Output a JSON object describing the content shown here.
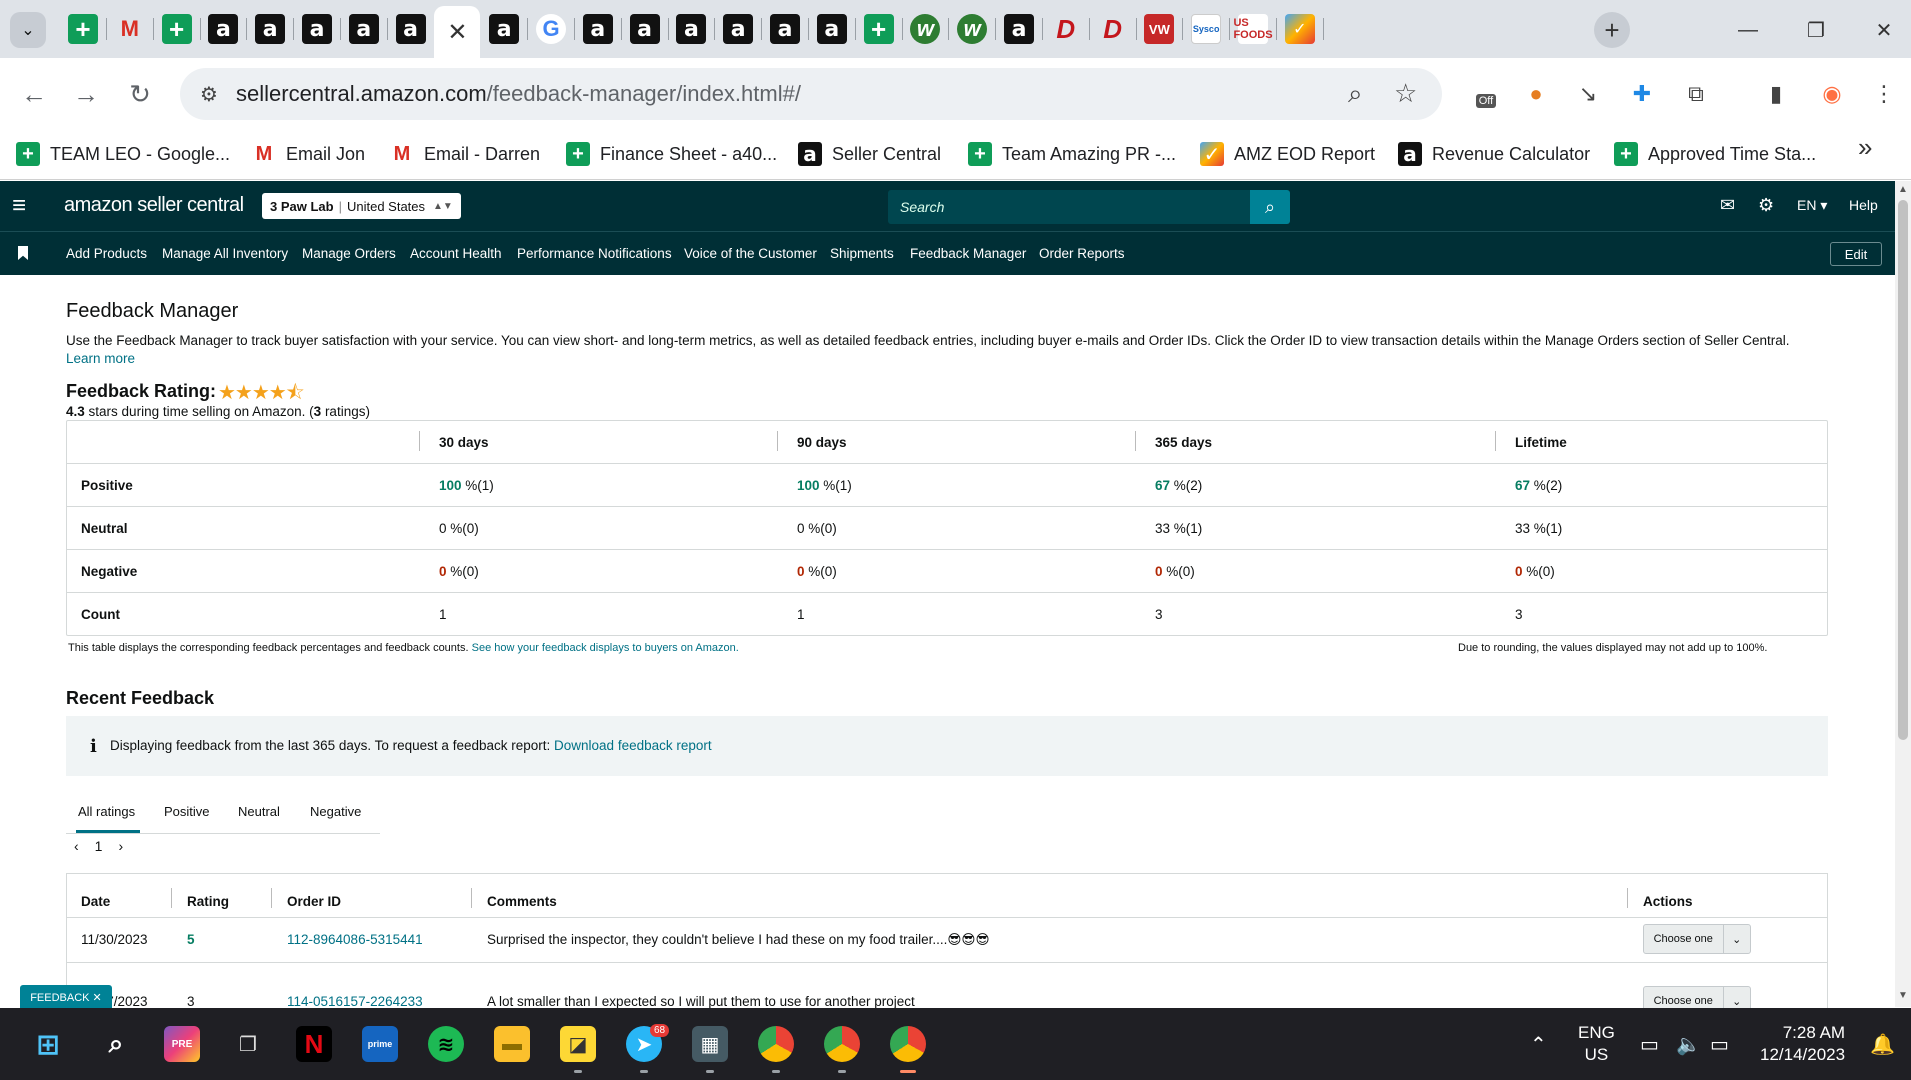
{
  "browser": {
    "url_host": "sellercentral.amazon.com",
    "url_path": "/feedback-manager/index.html#/",
    "bookmarks": [
      {
        "label": "TEAM LEO - Google...",
        "icon": "sheets-icon"
      },
      {
        "label": "Email Jon",
        "icon": "gmail-icon"
      },
      {
        "label": "Email - Darren",
        "icon": "gmail-icon"
      },
      {
        "label": "Finance Sheet - a40...",
        "icon": "sheets-icon"
      },
      {
        "label": "Seller Central",
        "icon": "amazon-icon"
      },
      {
        "label": "Team Amazing PR -...",
        "icon": "sheets-icon"
      },
      {
        "label": "AMZ EOD Report",
        "icon": "amz-icon"
      },
      {
        "label": "Revenue Calculator",
        "icon": "amazon-icon"
      },
      {
        "label": "Approved Time Sta...",
        "icon": "sheets-icon"
      }
    ],
    "ext_badge": "Off",
    "tabs": [
      {
        "icon": "sheets",
        "glyph": "+"
      },
      {
        "icon": "gmail",
        "glyph": "M"
      },
      {
        "icon": "sheets",
        "glyph": "+"
      },
      {
        "icon": "amazon",
        "glyph": "a"
      },
      {
        "icon": "amazon",
        "glyph": "a"
      },
      {
        "icon": "amazon",
        "glyph": "a"
      },
      {
        "icon": "amazon",
        "glyph": "a"
      },
      {
        "icon": "amazon",
        "glyph": "a"
      },
      {
        "icon": "active-close",
        "glyph": "✕"
      },
      {
        "icon": "amazon",
        "glyph": "a"
      },
      {
        "icon": "google",
        "glyph": "G"
      },
      {
        "icon": "amazon",
        "glyph": "a"
      },
      {
        "icon": "amazon",
        "glyph": "a"
      },
      {
        "icon": "amazon",
        "glyph": "a"
      },
      {
        "icon": "amazon",
        "glyph": "a"
      },
      {
        "icon": "amazon",
        "glyph": "a"
      },
      {
        "icon": "amazon",
        "glyph": "a"
      },
      {
        "icon": "sheets",
        "glyph": "+"
      },
      {
        "icon": "w",
        "glyph": "w"
      },
      {
        "icon": "w",
        "glyph": "w"
      },
      {
        "icon": "amazon",
        "glyph": "a"
      },
      {
        "icon": "pinterest",
        "glyph": "D"
      },
      {
        "icon": "pinterest",
        "glyph": "D"
      },
      {
        "icon": "vw",
        "glyph": "VW"
      },
      {
        "icon": "sysco",
        "glyph": "Sysco"
      },
      {
        "icon": "usfoods",
        "glyph": "US FOODS"
      },
      {
        "icon": "amz",
        "glyph": "✓"
      }
    ]
  },
  "header": {
    "logo": "amazon seller central",
    "store_name": "3 Paw Lab",
    "store_region": "United States",
    "search_placeholder": "Search",
    "language": "EN",
    "help": "Help"
  },
  "nav": {
    "links": [
      "Add Products",
      "Manage All Inventory",
      "Manage Orders",
      "Account Health",
      "Performance Notifications",
      "Voice of the Customer",
      "Shipments",
      "Feedback Manager",
      "Order Reports"
    ],
    "edit": "Edit"
  },
  "page": {
    "title": "Feedback Manager",
    "description": "Use the Feedback Manager to track buyer satisfaction with your service. You can view short- and long-term metrics, as well as detailed feedback entries, including buyer e-mails and Order IDs. Click the Order ID to view transaction details within the Manage Orders section of Seller Central.",
    "learn_more": "Learn more",
    "rating_label": "Feedback Rating:",
    "stars": "★★★★⯪",
    "rating_value": "4.3",
    "rating_text": "stars during time selling on Amazon. (",
    "rating_count": "3",
    "rating_count_suffix": "ratings)"
  },
  "feedback_table": {
    "columns": [
      "30 days",
      "90 days",
      "365 days",
      "Lifetime"
    ],
    "rows": [
      {
        "label": "Positive",
        "cells": [
          {
            "v": "100",
            "s": " %(1)"
          },
          {
            "v": "100",
            "s": " %(1)"
          },
          {
            "v": "67",
            "s": " %(2)"
          },
          {
            "v": "67",
            "s": " %(2)"
          }
        ]
      },
      {
        "label": "Neutral",
        "cells": [
          {
            "v": "0",
            "s": " %(0)"
          },
          {
            "v": "0",
            "s": " %(0)"
          },
          {
            "v": "33",
            "s": " %(1)"
          },
          {
            "v": "33",
            "s": " %(1)"
          }
        ]
      },
      {
        "label": "Negative",
        "cells": [
          {
            "v": "0",
            "s": " %(0)"
          },
          {
            "v": "0",
            "s": " %(0)"
          },
          {
            "v": "0",
            "s": " %(0)"
          },
          {
            "v": "0",
            "s": " %(0)"
          }
        ]
      },
      {
        "label": "Count",
        "cells": [
          {
            "v": "1",
            "s": ""
          },
          {
            "v": "1",
            "s": ""
          },
          {
            "v": "3",
            "s": ""
          },
          {
            "v": "3",
            "s": ""
          }
        ]
      }
    ],
    "note": "This table displays the corresponding feedback percentages and feedback counts.",
    "note_link": "See how your feedback displays to buyers on Amazon.",
    "rounding_note": "Due to rounding, the values displayed may not add up to 100%."
  },
  "recent": {
    "title": "Recent Feedback",
    "info": "Displaying feedback from the last 365 days. To request a feedback report:",
    "info_link": "Download feedback report",
    "tabs": [
      "All ratings",
      "Positive",
      "Neutral",
      "Negative"
    ],
    "page": "1",
    "columns": {
      "date": "Date",
      "rating": "Rating",
      "order_id": "Order ID",
      "comments": "Comments",
      "actions": "Actions"
    },
    "rows": [
      {
        "date": "11/30/2023",
        "rating": "5",
        "order_id": "112-8964086-5315441",
        "comment": "Surprised the inspector, they couldn't believe I had these on my food trailer....😎😎😎",
        "action": "Choose one"
      },
      {
        "date": "11/27/2023",
        "rating": "3",
        "order_id": "114-0516157-2264233",
        "comment": "A lot smaller than I expected so I will put them to use for another project",
        "action": "Choose one"
      }
    ],
    "feedback_tab": "FEEDBACK ✕"
  },
  "taskbar": {
    "telegram_badge": "68",
    "lang1": "ENG",
    "lang2": "US",
    "time": "7:28 AM",
    "date": "12/14/2023"
  }
}
